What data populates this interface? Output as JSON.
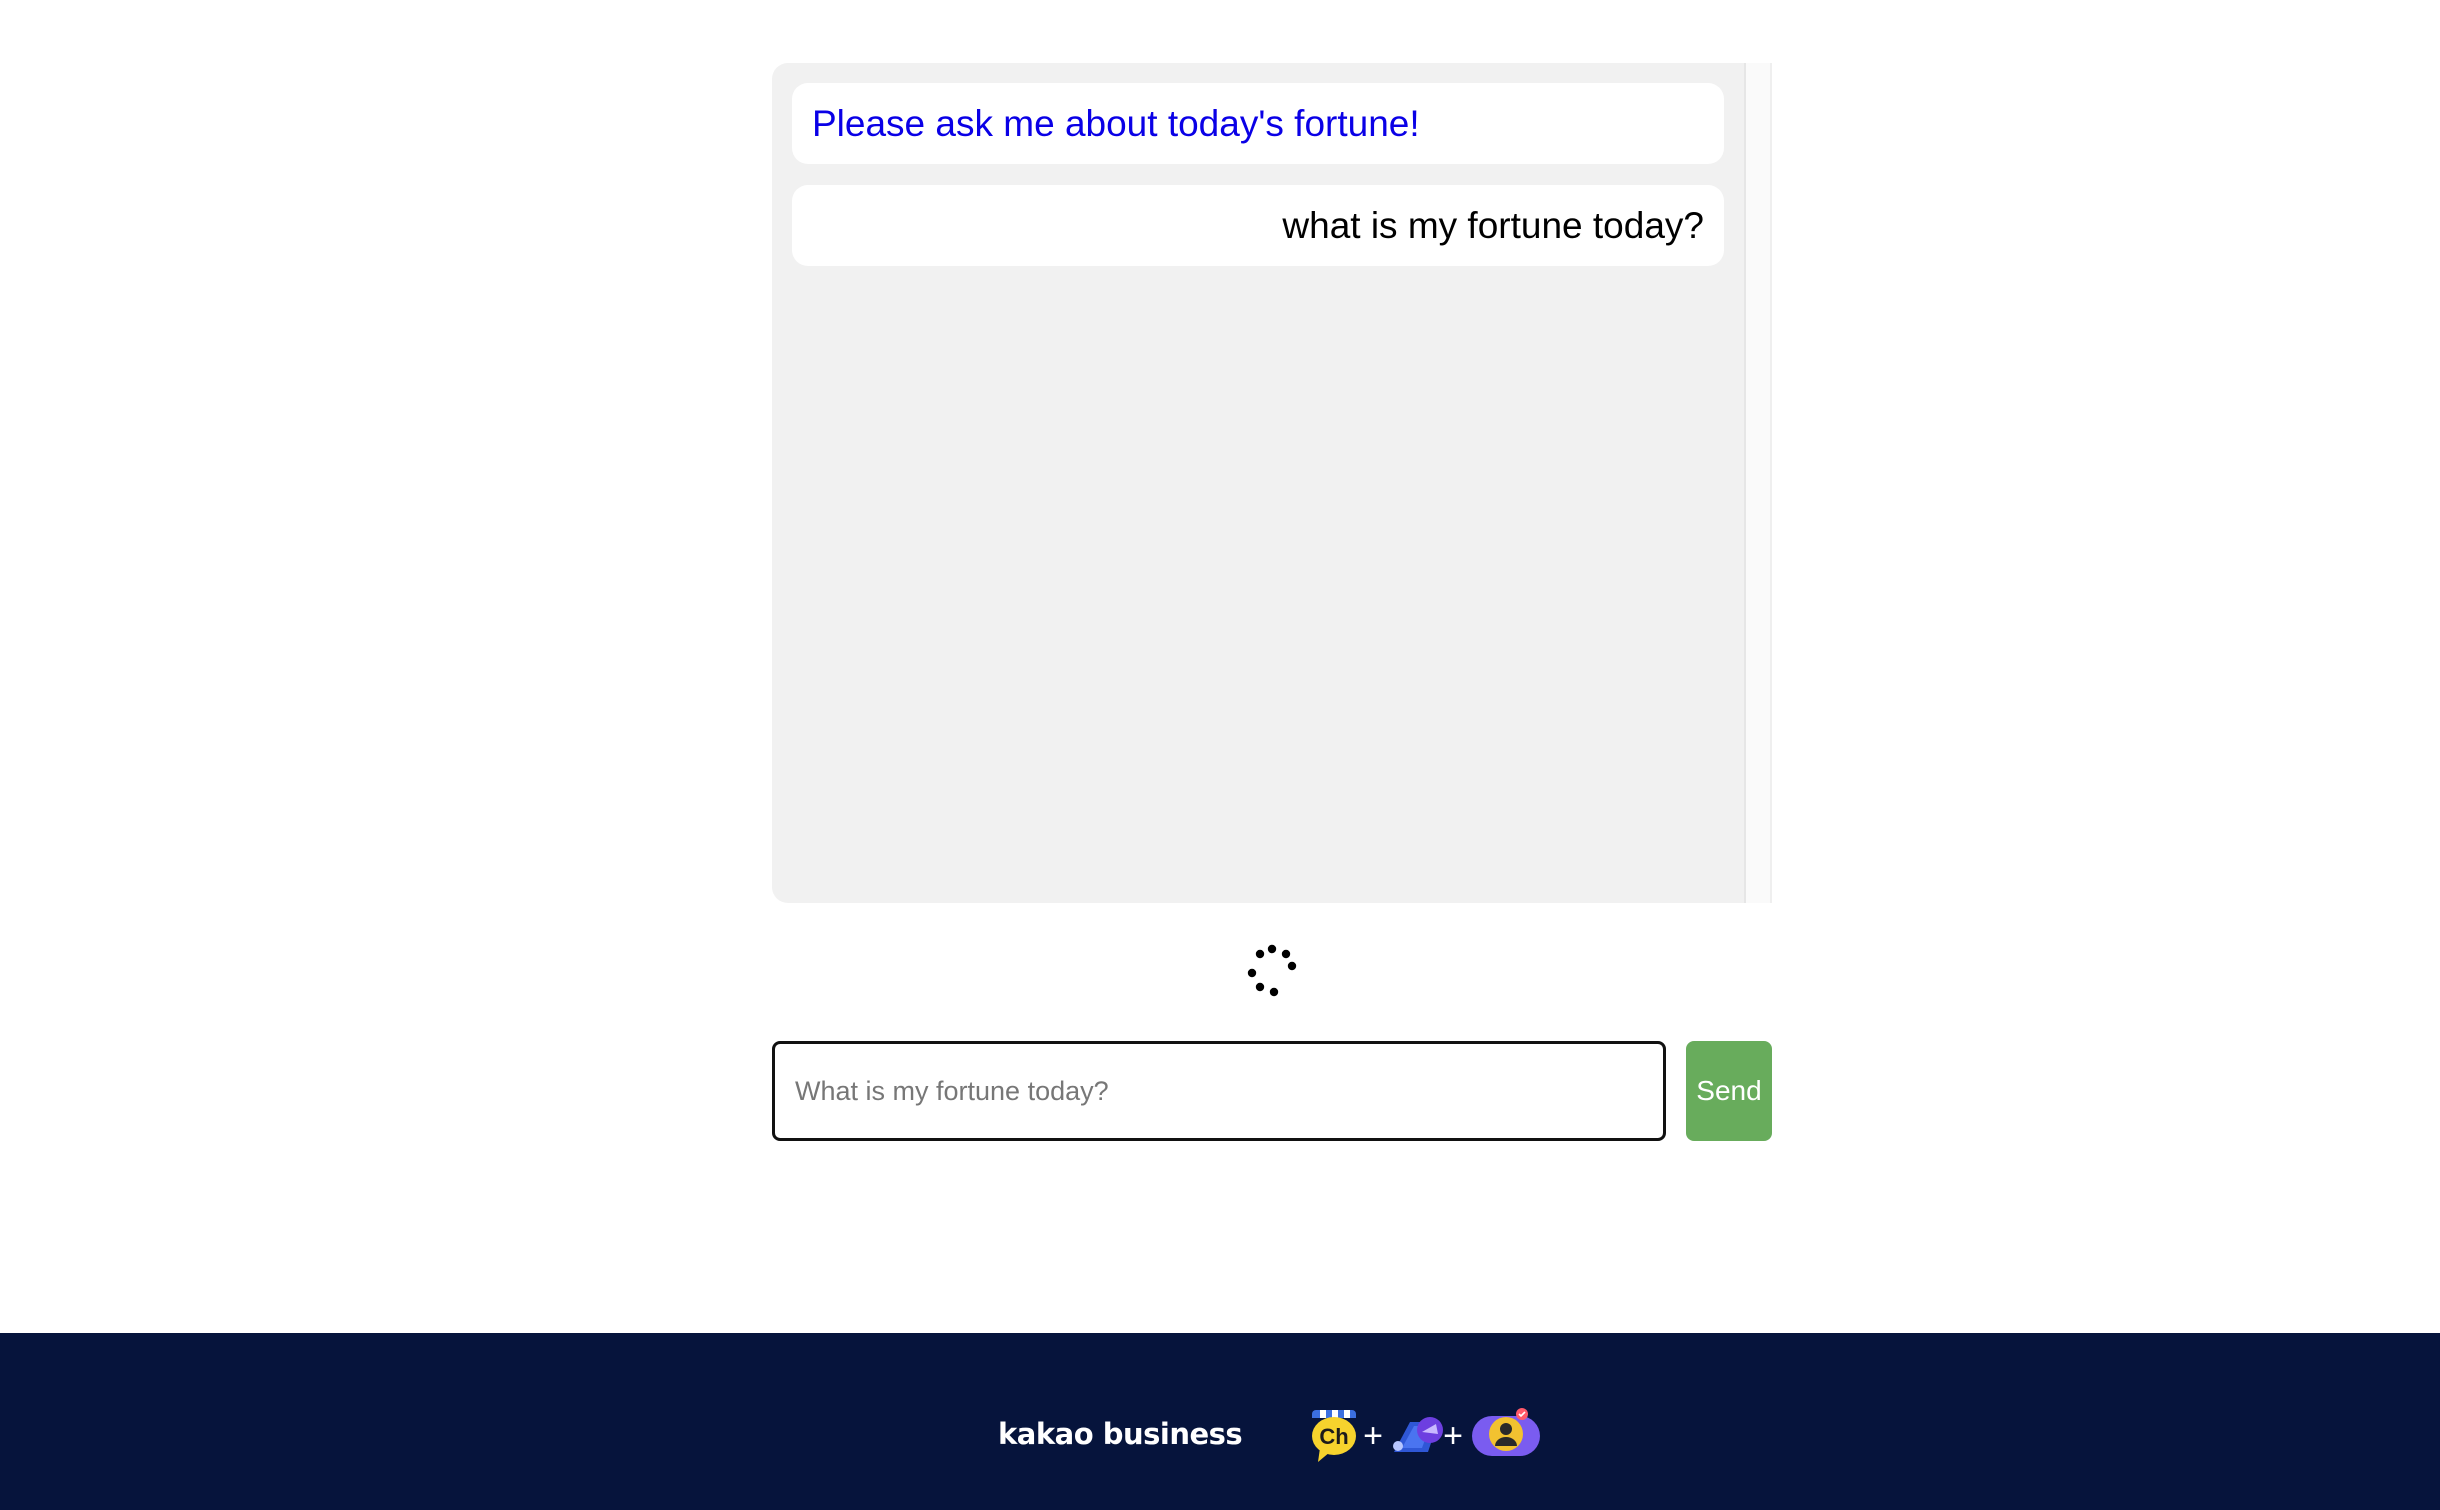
{
  "chat": {
    "messages": [
      {
        "role": "bot",
        "text": "Please ask me about today's fortune!"
      },
      {
        "role": "user",
        "text": "what is my fortune today?"
      }
    ]
  },
  "input": {
    "placeholder": "What is my fortune today?",
    "value": ""
  },
  "send_button": {
    "label": "Send"
  },
  "footer": {
    "brand": "kakao business",
    "channel_icon_text": "Ch",
    "plus_sign": "+"
  },
  "colors": {
    "bot_text": "#0a00e6",
    "send_button": "#68ac5c",
    "footer_bg": "#06143c",
    "chat_bg": "#f1f1f1"
  },
  "icons": [
    "loading-spinner-icon",
    "kakao-channel-icon",
    "megaphone-icon",
    "profile-badge-icon"
  ]
}
